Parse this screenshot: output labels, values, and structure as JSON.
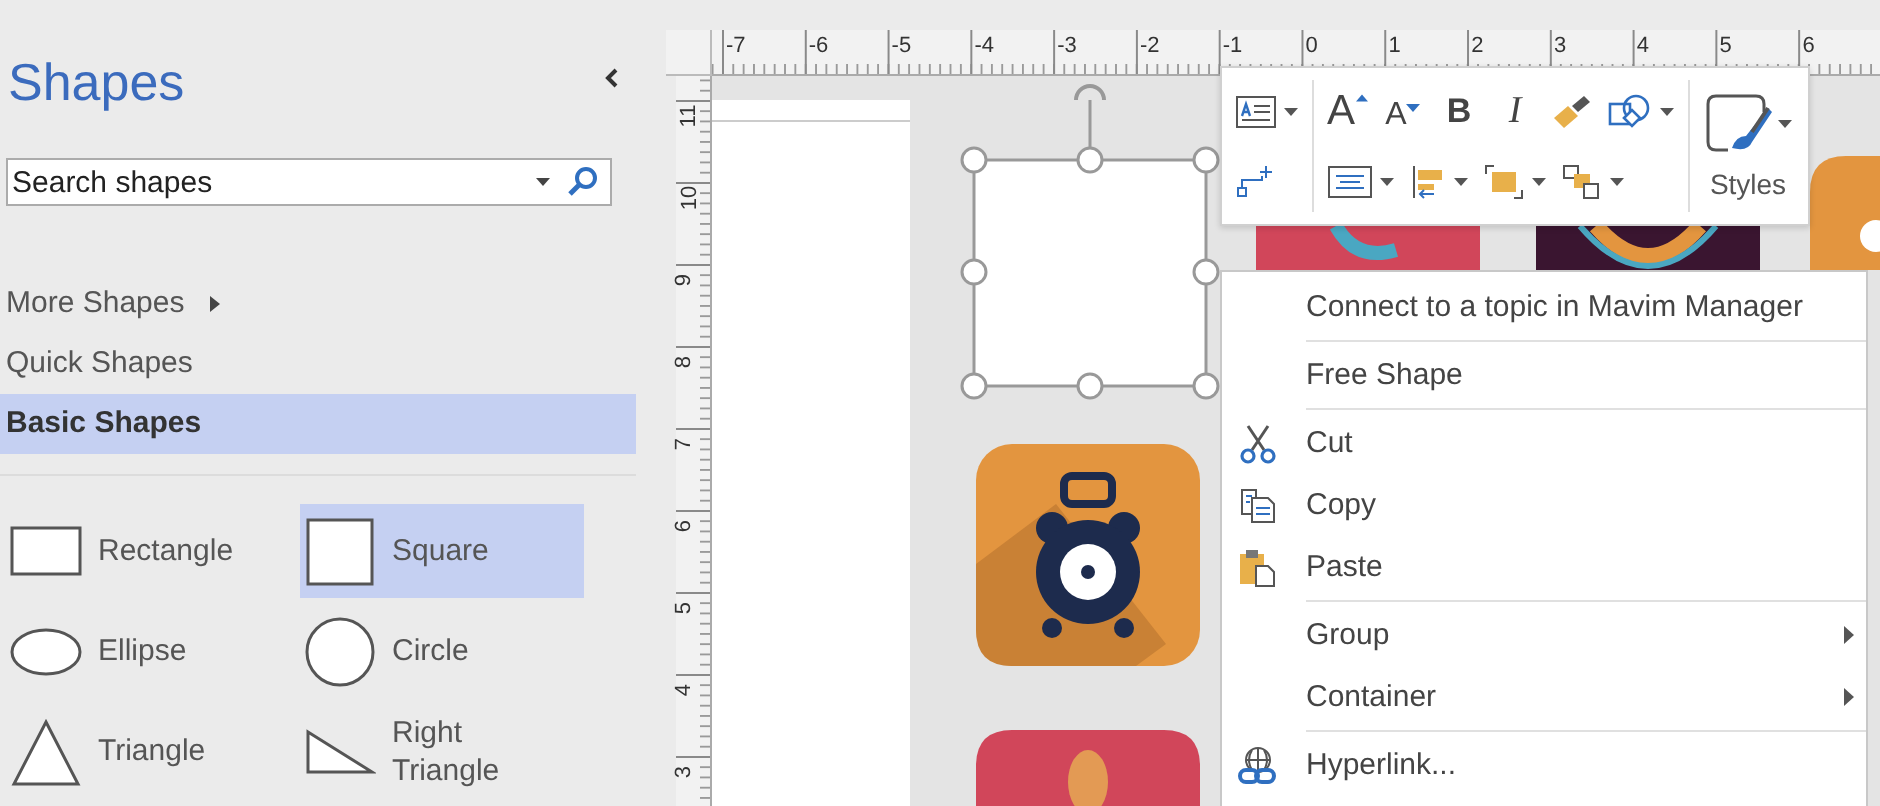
{
  "sidebar": {
    "title": "Shapes",
    "search": {
      "placeholder": "Search shapes"
    },
    "categories": [
      {
        "label": "More Shapes",
        "selected": false,
        "submenu": true
      },
      {
        "label": "Quick Shapes",
        "selected": false,
        "submenu": false
      },
      {
        "label": "Basic Shapes",
        "selected": true,
        "submenu": false
      }
    ],
    "stencil": [
      {
        "label": "Rectangle",
        "kind": "rectangle",
        "selected": false
      },
      {
        "label": "Square",
        "kind": "square",
        "selected": true
      },
      {
        "label": "Ellipse",
        "kind": "ellipse",
        "selected": false
      },
      {
        "label": "Circle",
        "kind": "circle",
        "selected": false
      },
      {
        "label": "Triangle",
        "kind": "triangle",
        "selected": false
      },
      {
        "label": "Right Triangle",
        "kind": "right-triangle",
        "selected": false
      }
    ]
  },
  "rulers": {
    "horizontal": [
      "-7",
      "-6",
      "-5",
      "-4",
      "-3",
      "-2",
      "-1",
      "0",
      "1",
      "2",
      "3",
      "4",
      "5",
      "6"
    ],
    "vertical": [
      "11",
      "10",
      "9",
      "8",
      "7",
      "6",
      "5",
      "4",
      "3"
    ]
  },
  "mini_toolbar": {
    "font_buttons": [
      {
        "label": "A",
        "kind": "grow"
      },
      {
        "label": "A",
        "kind": "shrink"
      },
      {
        "label": "B",
        "kind": "bold"
      },
      {
        "label": "I",
        "kind": "italic"
      }
    ],
    "styles_label": "Styles"
  },
  "context_menu": {
    "groups": [
      [
        {
          "label": "Connect to a topic in Mavim Manager",
          "kind": "plain",
          "submenu": false
        }
      ],
      [
        {
          "label": "Free Shape",
          "kind": "plain",
          "submenu": false
        }
      ],
      [
        {
          "label": "Cut",
          "kind": "cut",
          "submenu": false
        },
        {
          "label": "Copy",
          "kind": "copy",
          "submenu": false
        },
        {
          "label": "Paste",
          "kind": "paste",
          "submenu": false
        }
      ],
      [
        {
          "label": "Group",
          "kind": "plain",
          "submenu": true
        },
        {
          "label": "Container",
          "kind": "plain",
          "submenu": true
        }
      ],
      [
        {
          "label": "Hyperlink...",
          "kind": "hyperlink",
          "submenu": false
        }
      ]
    ]
  }
}
